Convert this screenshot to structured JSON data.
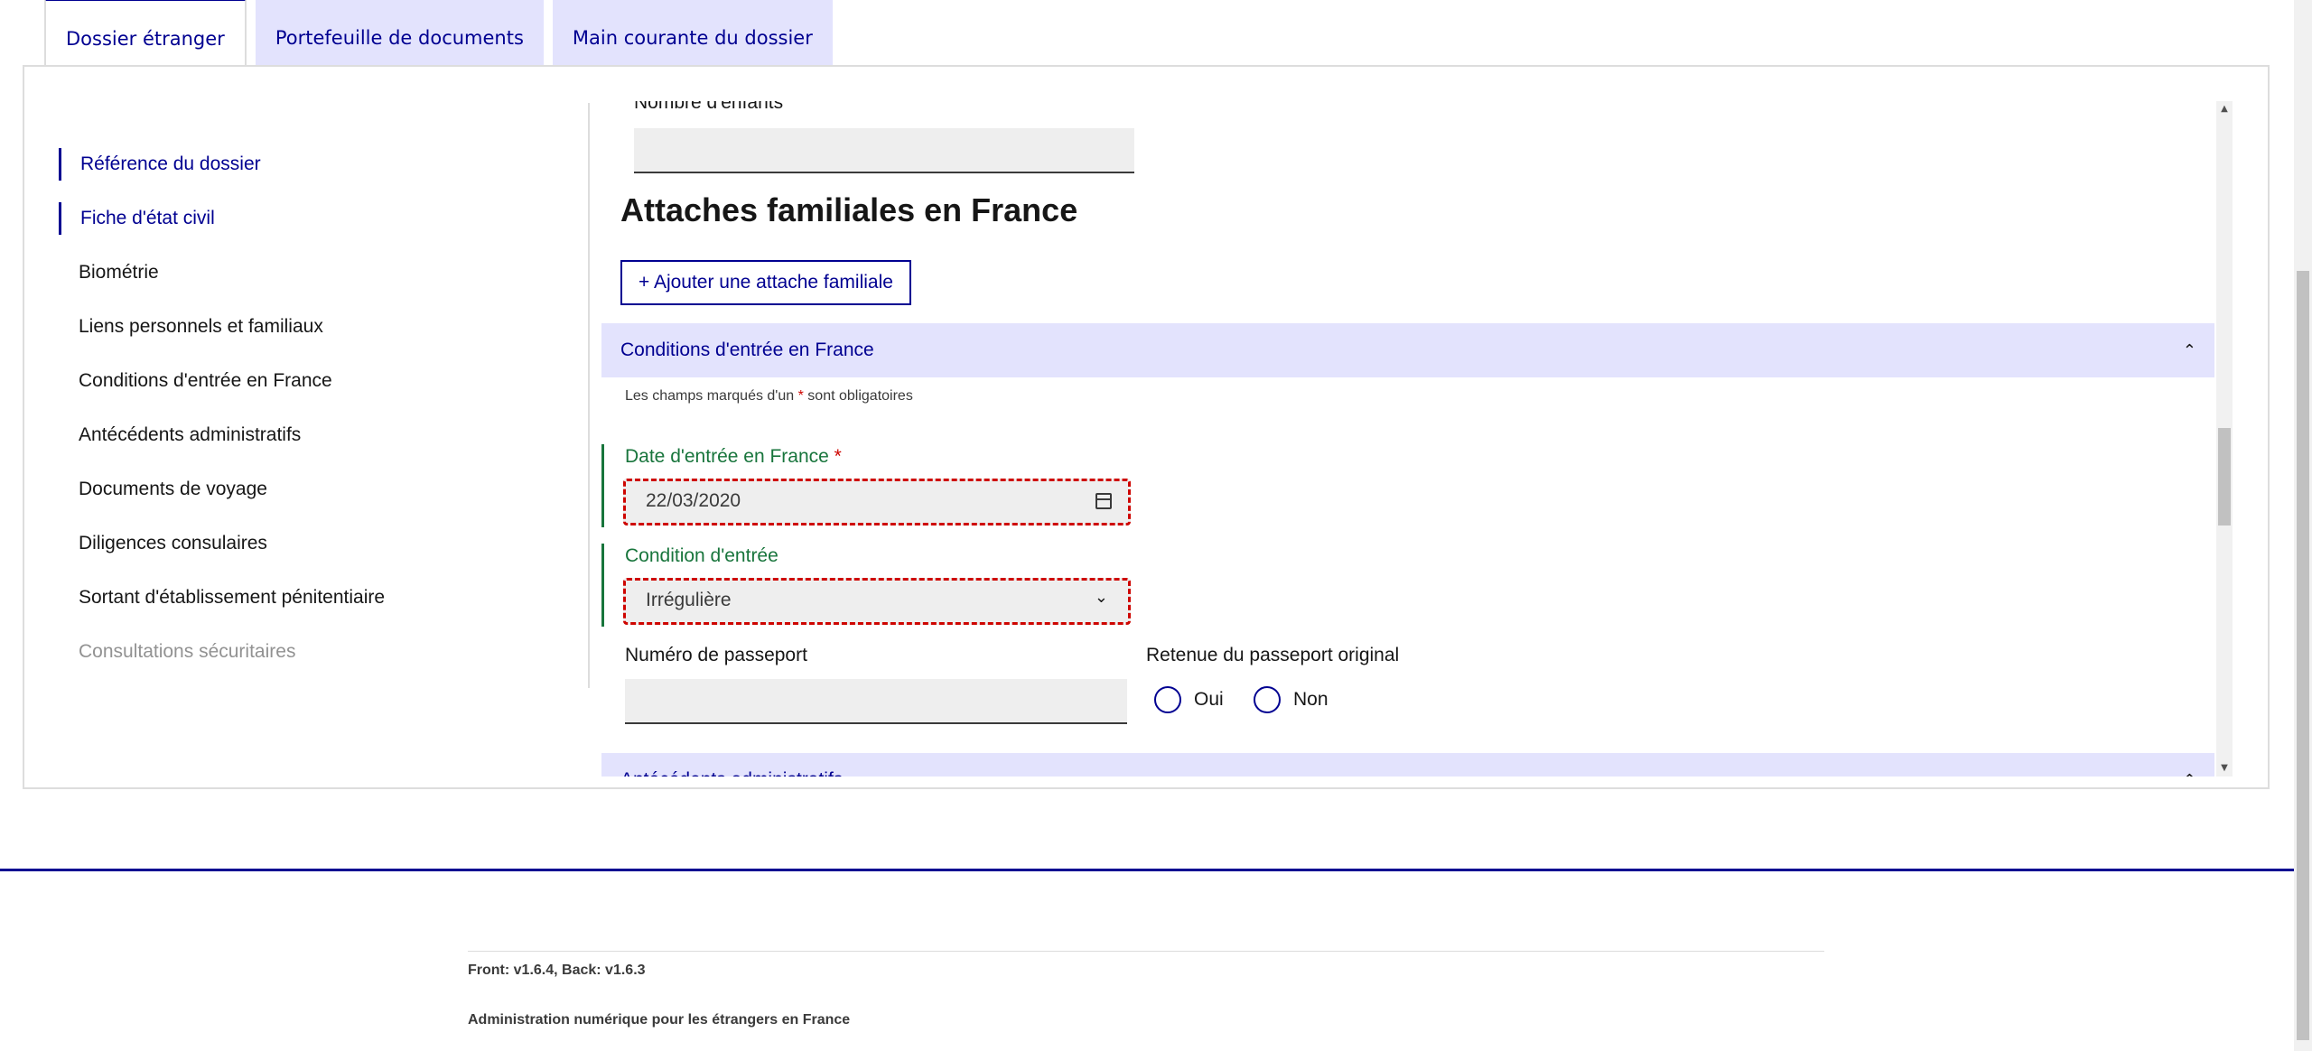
{
  "tabs": [
    {
      "label": "Dossier étranger"
    },
    {
      "label": "Portefeuille de documents"
    },
    {
      "label": "Main courante du dossier"
    }
  ],
  "sidenav": {
    "items": [
      {
        "label": "Référence du dossier"
      },
      {
        "label": "Fiche d'état civil"
      },
      {
        "label": "Biométrie"
      },
      {
        "label": "Liens personnels et familiaux"
      },
      {
        "label": "Conditions d'entrée en France"
      },
      {
        "label": "Antécédents administratifs"
      },
      {
        "label": "Documents de voyage"
      },
      {
        "label": "Diligences consulaires"
      },
      {
        "label": "Sortant d'établissement pénitentiaire"
      },
      {
        "label": "Consultations sécuritaires"
      }
    ]
  },
  "form": {
    "children_label": "Nombre d'enfants",
    "children_value": "",
    "family_heading": "Attaches familiales en France",
    "add_family_button": "+ Ajouter une attache familiale",
    "entry_section": {
      "title": "Conditions d'entrée en France",
      "required_note_pre": "Les champs marqués d'un",
      "required_star": "*",
      "required_note_post": "sont obligatoires",
      "entry_date_label": "Date d'entrée en France",
      "entry_date_value": "22/03/2020",
      "condition_label": "Condition d'entrée",
      "condition_value": "Irrégulière",
      "passport_label": "Numéro de passeport",
      "passport_value": "",
      "retention_label": "Retenue du passeport original",
      "radio_yes": "Oui",
      "radio_no": "Non"
    },
    "next_section_title": "Antécédents administratifs"
  },
  "footer": {
    "version": "Front: v1.6.4, Back: v1.6.3",
    "tagline": "Administration numérique pour les étrangers en France"
  },
  "colors": {
    "primary": "#000091",
    "success": "#18753c",
    "error": "#ce0500",
    "accordion_bg": "#e3e3fd"
  }
}
